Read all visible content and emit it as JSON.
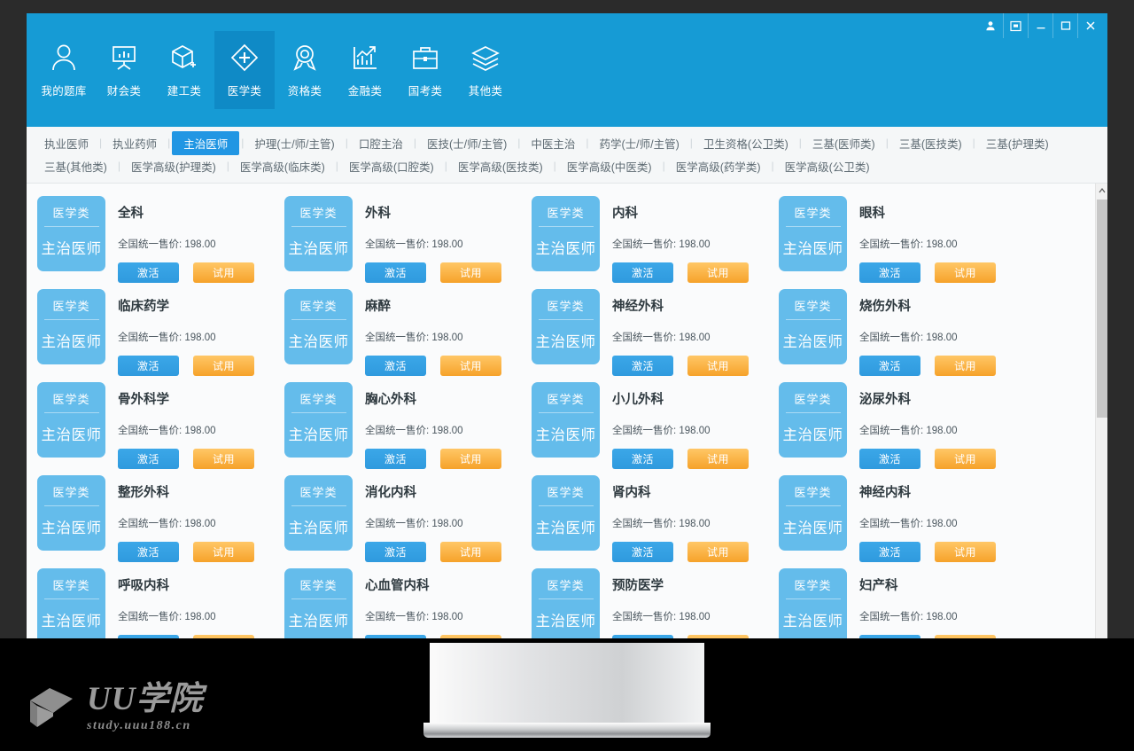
{
  "window": {
    "controls": [
      {
        "name": "account-icon",
        "label": "账户"
      },
      {
        "name": "skin-icon",
        "label": "换肤"
      },
      {
        "name": "minimize-icon",
        "label": "最小化"
      },
      {
        "name": "maximize-icon",
        "label": "最大化"
      },
      {
        "name": "close-icon",
        "label": "关闭"
      }
    ]
  },
  "topnav": {
    "items": [
      {
        "label": "我的题库",
        "icon": "user-icon",
        "active": false
      },
      {
        "label": "财会类",
        "icon": "presentation-board-icon",
        "active": false
      },
      {
        "label": "建工类",
        "icon": "cube-plus-icon",
        "active": false
      },
      {
        "label": "医学类",
        "icon": "medical-diamond-plus-icon",
        "active": true
      },
      {
        "label": "资格类",
        "icon": "award-medal-icon",
        "active": false
      },
      {
        "label": "金融类",
        "icon": "bar-chart-arrow-icon",
        "active": false
      },
      {
        "label": "国考类",
        "icon": "briefcase-icon",
        "active": false
      },
      {
        "label": "其他类",
        "icon": "layers-icon",
        "active": false
      }
    ]
  },
  "subnav": {
    "row1": [
      {
        "label": "执业医师",
        "active": false
      },
      {
        "label": "执业药师",
        "active": false
      },
      {
        "label": "主治医师",
        "active": true
      },
      {
        "label": "护理(士/师/主管)",
        "active": false
      },
      {
        "label": "口腔主治",
        "active": false
      },
      {
        "label": "医技(士/师/主管)",
        "active": false
      },
      {
        "label": "中医主治",
        "active": false
      },
      {
        "label": "药学(士/师/主管)",
        "active": false
      },
      {
        "label": "卫生资格(公卫类)",
        "active": false
      },
      {
        "label": "三基(医师类)",
        "active": false
      },
      {
        "label": "三基(医技类)",
        "active": false
      },
      {
        "label": "三基(护理类)",
        "active": false
      }
    ],
    "row2": [
      {
        "label": "三基(其他类)",
        "active": false
      },
      {
        "label": "医学高级(护理类)",
        "active": false
      },
      {
        "label": "医学高级(临床类)",
        "active": false
      },
      {
        "label": "医学高级(口腔类)",
        "active": false
      },
      {
        "label": "医学高级(医技类)",
        "active": false
      },
      {
        "label": "医学高级(中医类)",
        "active": false
      },
      {
        "label": "医学高级(药学类)",
        "active": false
      },
      {
        "label": "医学高级(公卫类)",
        "active": false
      }
    ],
    "separator": "|"
  },
  "cards": {
    "badge_top": "医学类",
    "badge_bottom": "主治医师",
    "price_label": "全国统一售价:",
    "price_value": "198.00",
    "activate_label": "激活",
    "trial_label": "试用",
    "items": [
      {
        "title": "全科"
      },
      {
        "title": "外科"
      },
      {
        "title": "内科"
      },
      {
        "title": "眼科"
      },
      {
        "title": "临床药学"
      },
      {
        "title": "麻醉"
      },
      {
        "title": "神经外科"
      },
      {
        "title": "烧伤外科"
      },
      {
        "title": "骨外科学"
      },
      {
        "title": "胸心外科"
      },
      {
        "title": "小儿外科"
      },
      {
        "title": "泌尿外科"
      },
      {
        "title": "整形外科"
      },
      {
        "title": "消化内科"
      },
      {
        "title": "肾内科"
      },
      {
        "title": "神经内科"
      },
      {
        "title": "呼吸内科"
      },
      {
        "title": "心血管内科"
      },
      {
        "title": "预防医学"
      },
      {
        "title": "妇产科"
      }
    ]
  },
  "watermark": {
    "title": "UU学院",
    "subtitle": "study.uuu188.cn"
  },
  "colors": {
    "brand_blue": "#169bd5",
    "active_tab_blue": "#0f8ac6",
    "subnav_active": "#2196e3",
    "badge_blue": "#64bceb",
    "button_blue": "#2f9ade",
    "button_orange": "#f6a22a"
  }
}
